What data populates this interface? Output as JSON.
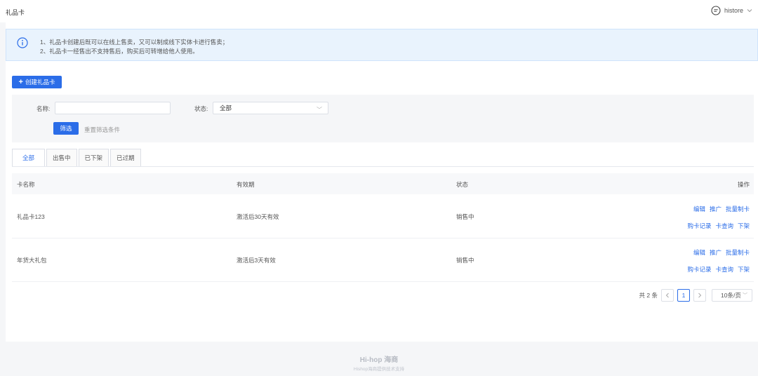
{
  "header": {
    "title": "礼品卡",
    "username": "histore"
  },
  "notice": {
    "line1": "1、礼品卡创建后既可以在线上售卖，又可以制成线下实体卡进行售卖；",
    "line2": "2、礼品卡一经售出不支持售后，购买后可转增给他人使用。"
  },
  "toolbar": {
    "create_label": "创建礼品卡"
  },
  "filter": {
    "name_label": "名称:",
    "name_value": "",
    "status_label": "状态:",
    "status_value": "全部",
    "submit_label": "筛选",
    "reset_label": "重置筛选条件"
  },
  "tabs": [
    {
      "label": "全部"
    },
    {
      "label": "出售中"
    },
    {
      "label": "已下架"
    },
    {
      "label": "已过期"
    }
  ],
  "table": {
    "columns": [
      "卡名称",
      "有效期",
      "状态",
      "操作"
    ],
    "rows": [
      {
        "name": "礼品卡123",
        "validity": "激活后30天有效",
        "status": "销售中",
        "ops_row1": [
          "编辑",
          "推广",
          "批量制卡"
        ],
        "ops_row2": [
          "购卡记录",
          "卡查询",
          "下架"
        ]
      },
      {
        "name": "年货大礼包",
        "validity": "激活后3天有效",
        "status": "销售中",
        "ops_row1": [
          "编辑",
          "推广",
          "批量制卡"
        ],
        "ops_row2": [
          "购卡记录",
          "卡查询",
          "下架"
        ]
      }
    ]
  },
  "pagination": {
    "total_text": "共 2 条",
    "current_page": "1",
    "page_size": "10条/页"
  },
  "footer": {
    "logo": "Hi-hop 海商",
    "sub": "Hishop海商提供技术支持"
  },
  "colors": {
    "accent": "#2b6de8",
    "notice_bg": "#e9f3fd"
  }
}
